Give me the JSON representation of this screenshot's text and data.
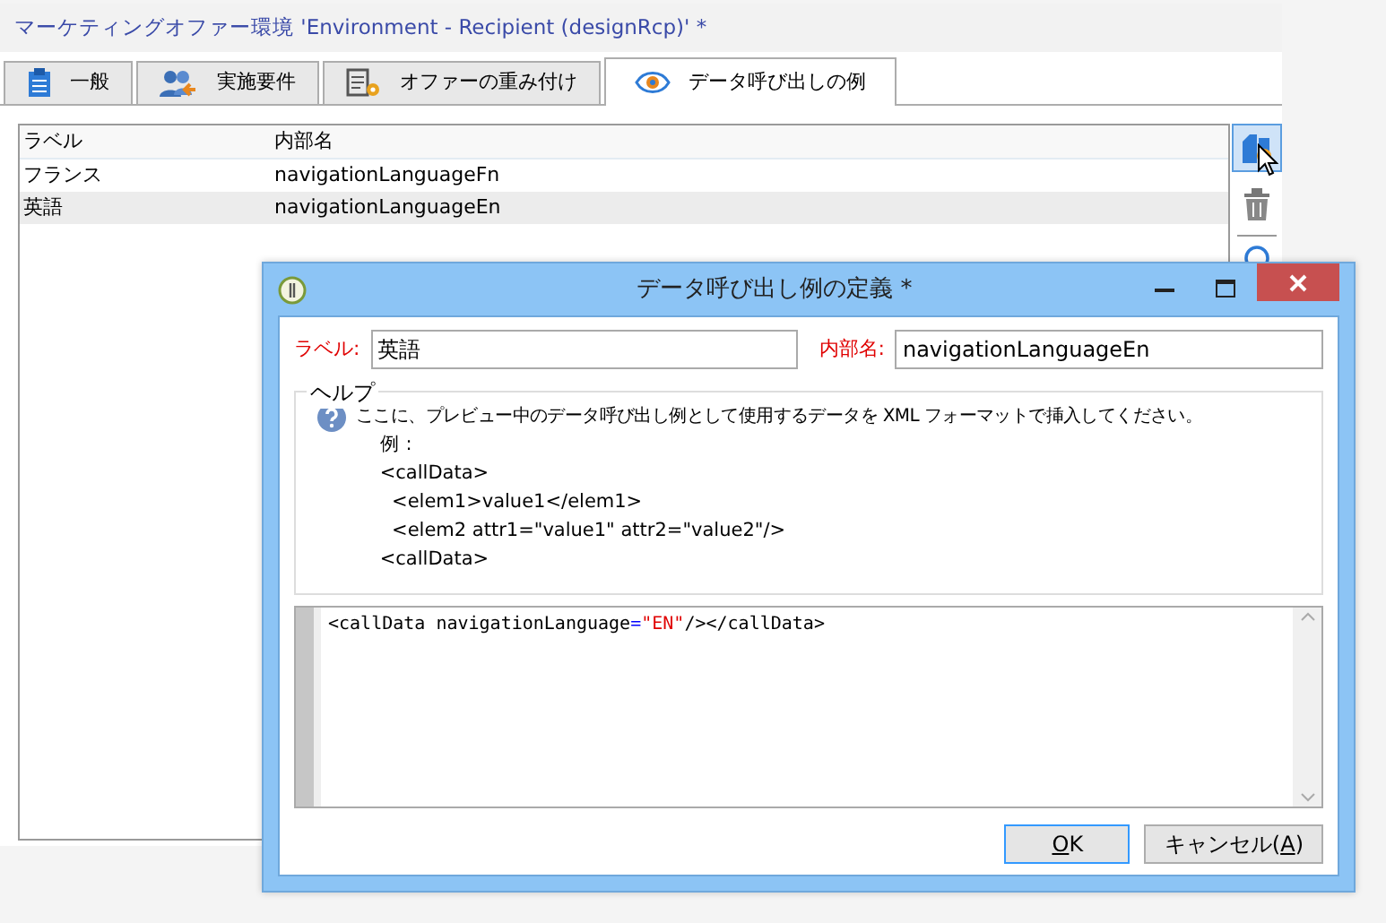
{
  "window": {
    "title": "マーケティングオファー環境 'Environment - Recipient (designRcp)' *"
  },
  "tabs": [
    {
      "label": "一般",
      "selected": false
    },
    {
      "label": "実施要件",
      "selected": false
    },
    {
      "label": "オファーの重み付け",
      "selected": false
    },
    {
      "label": "データ呼び出しの例",
      "selected": true
    }
  ],
  "table": {
    "columns": [
      "ラベル",
      "内部名"
    ],
    "rows": [
      {
        "cells": [
          "フランス",
          "navigationLanguageFn"
        ],
        "selected": false
      },
      {
        "cells": [
          "英語",
          "navigationLanguageEn"
        ],
        "selected": true
      }
    ]
  },
  "toolbar": [
    {
      "kind": "add",
      "selected": true
    },
    {
      "kind": "delete",
      "selected": false
    },
    {
      "kind": "divider"
    },
    {
      "kind": "search"
    }
  ],
  "dialog": {
    "title": "データ呼び出し例の定義 *",
    "fields": [
      {
        "label": "ラベル:",
        "value": "英語"
      },
      {
        "label": "内部名:",
        "value": "navigationLanguageEn"
      }
    ],
    "help": {
      "legend": "ヘルプ",
      "text": "ここに、プレビュー中のデータ呼び出し例として使用するデータを XML フォーマットで挿入してください。",
      "example": "    例 :\n    <callData>\n      <elem1>value1</elem1>\n      <elem2 attr1=\"value1\" attr2=\"value2\"/>\n    <callData>"
    },
    "code": [
      {
        "text": "<callData navigationLanguage",
        "kind": "plain"
      },
      {
        "text": "=",
        "kind": "operator"
      },
      {
        "text": "\"EN\"",
        "kind": "string"
      },
      {
        "text": "/></callData>",
        "kind": "plain"
      }
    ],
    "buttons": [
      {
        "kind": "default",
        "parts": [
          {
            "text": "O",
            "underlined": true
          },
          {
            "text": "K",
            "underlined": false
          }
        ]
      },
      {
        "kind": "normal",
        "parts": [
          {
            "text": "キャンセル(",
            "underlined": false
          },
          {
            "text": "A",
            "underlined": true
          },
          {
            "text": ")",
            "underlined": false
          }
        ]
      }
    ]
  }
}
